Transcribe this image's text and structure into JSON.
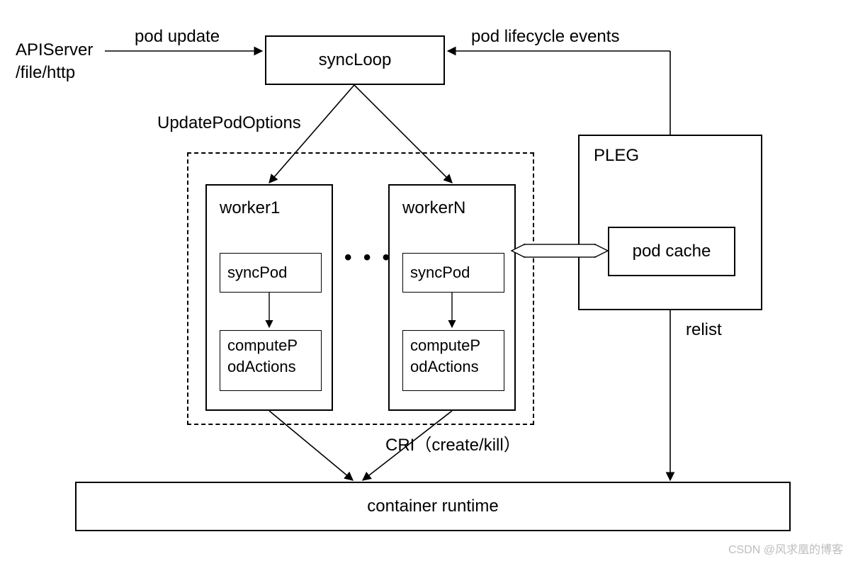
{
  "source": {
    "label": "APIServer\n/file/http"
  },
  "edges": {
    "pod_update": "pod update",
    "pod_lifecycle": "pod lifecycle events",
    "update_pod_options": "UpdatePodOptions",
    "cri": "CRI（create/kill）",
    "relist": "relist"
  },
  "nodes": {
    "syncLoop": "syncLoop",
    "pleg": "PLEG",
    "pod_cache": "pod cache",
    "container_runtime": "container runtime"
  },
  "workers": {
    "ellipsis": "• • •",
    "items": [
      {
        "title": "worker1",
        "syncPod": "syncPod",
        "compute": "computeP\nodActions"
      },
      {
        "title": "workerN",
        "syncPod": "syncPod",
        "compute": "computeP\nodActions"
      }
    ]
  },
  "watermark": "CSDN @风求凰的博客"
}
